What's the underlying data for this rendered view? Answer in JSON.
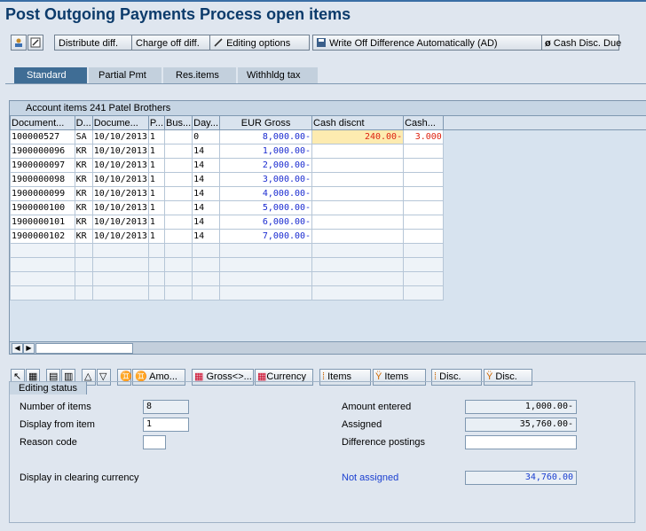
{
  "window": {
    "title": "Post Outgoing Payments Process open items"
  },
  "toolbar": {
    "distribute_diff": "Distribute diff.",
    "charge_off_diff": "Charge off diff.",
    "editing_options": "Editing options",
    "write_off_auto": "Write Off Difference Automatically (AD)",
    "cash_disc_due": "Cash Disc. Due"
  },
  "tabs": [
    "Standard",
    "Partial Pmt",
    "Res.items",
    "Withhldg tax"
  ],
  "table": {
    "title": "Account items 241 Patel Brothers",
    "columns": [
      "Document...",
      "D...",
      "Docume...",
      "P...",
      "Bus...",
      "Day...",
      "EUR Gross",
      "Cash discnt",
      "Cash..."
    ],
    "rows": [
      [
        "100000527",
        "SA",
        "10/10/2013",
        "1",
        "",
        "0",
        "8,000.00-",
        "240.00-",
        "3.000"
      ],
      [
        "1900000096",
        "KR",
        "10/10/2013",
        "1",
        "",
        "14",
        "1,000.00-",
        "",
        ""
      ],
      [
        "1900000097",
        "KR",
        "10/10/2013",
        "1",
        "",
        "14",
        "2,000.00-",
        "",
        ""
      ],
      [
        "1900000098",
        "KR",
        "10/10/2013",
        "1",
        "",
        "14",
        "3,000.00-",
        "",
        ""
      ],
      [
        "1900000099",
        "KR",
        "10/10/2013",
        "1",
        "",
        "14",
        "4,000.00-",
        "",
        ""
      ],
      [
        "1900000100",
        "KR",
        "10/10/2013",
        "1",
        "",
        "14",
        "5,000.00-",
        "",
        ""
      ],
      [
        "1900000101",
        "KR",
        "10/10/2013",
        "1",
        "",
        "14",
        "6,000.00-",
        "",
        ""
      ],
      [
        "1900000102",
        "KR",
        "10/10/2013",
        "1",
        "",
        "14",
        "7,000.00-",
        "",
        ""
      ]
    ]
  },
  "bottom_toolbar": {
    "amo": "Amo...",
    "gross": "Gross<>...",
    "currency": "Currency",
    "items1": "Items",
    "items2": "Items",
    "disc1": "Disc.",
    "disc2": "Disc."
  },
  "editing_status": {
    "title": "Editing status",
    "number_of_items_label": "Number of items",
    "number_of_items": "8",
    "display_from_item_label": "Display from item",
    "display_from_item": "1",
    "reason_code_label": "Reason code",
    "reason_code": "",
    "display_clearing_label": "Display in clearing currency",
    "amount_entered_label": "Amount entered",
    "amount_entered": "1,000.00-",
    "assigned_label": "Assigned",
    "assigned": "35,760.00-",
    "difference_postings_label": "Difference postings",
    "difference_postings": "",
    "not_assigned_label": "Not assigned",
    "not_assigned": "34,760.00"
  },
  "colors": {
    "title": "#0c3b6b",
    "tab_active": "#3f6d95",
    "highlight": "#fdebb0",
    "amount_blue": "#1a2bd0",
    "discount_red": "#dd1111"
  }
}
